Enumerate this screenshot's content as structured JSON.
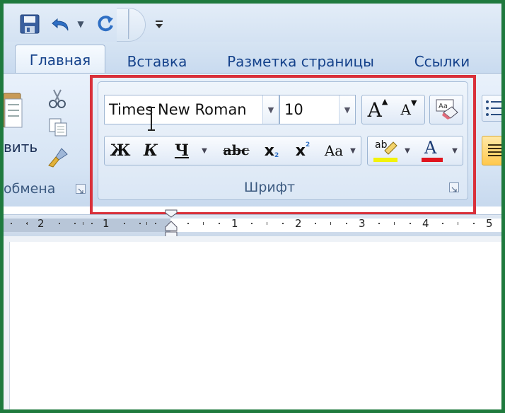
{
  "tabs": {
    "home": "Главная",
    "insert": "Вставка",
    "page_layout": "Разметка страницы",
    "references": "Ссылки"
  },
  "clipboard": {
    "paste_label_partial": "вить",
    "group_label_partial": "обмена"
  },
  "font_group": {
    "font_name": "Times New Roman",
    "font_size": "10",
    "bold": "Ж",
    "italic": "К",
    "underline": "Ч",
    "strikethrough": "abc",
    "subscript": "x",
    "subscript_mark": "2",
    "superscript": "x",
    "superscript_mark": "2",
    "change_case": "Aa",
    "grow_font": "A",
    "shrink_font": "A",
    "highlight_text": "ab",
    "font_color": "A",
    "group_label": "Шрифт"
  },
  "ruler": {
    "labels": [
      "2",
      "1",
      "1",
      "2",
      "3",
      "4",
      "5"
    ]
  },
  "colors": {
    "highlight_border": "#d9303a",
    "window_border": "#1f7a3e",
    "font_color_bar": "#e0141e",
    "highlight_color_bar": "#f2f20a"
  },
  "icons": {
    "save": "save-icon",
    "undo": "undo-icon",
    "redo": "redo-icon",
    "customize": "customize-qat-icon",
    "cut": "scissors-icon",
    "copy": "copy-icon",
    "format_painter": "format-painter-icon",
    "clear_formatting": "clear-formatting-icon",
    "bullets": "bullets-icon",
    "align": "align-justify-icon"
  }
}
